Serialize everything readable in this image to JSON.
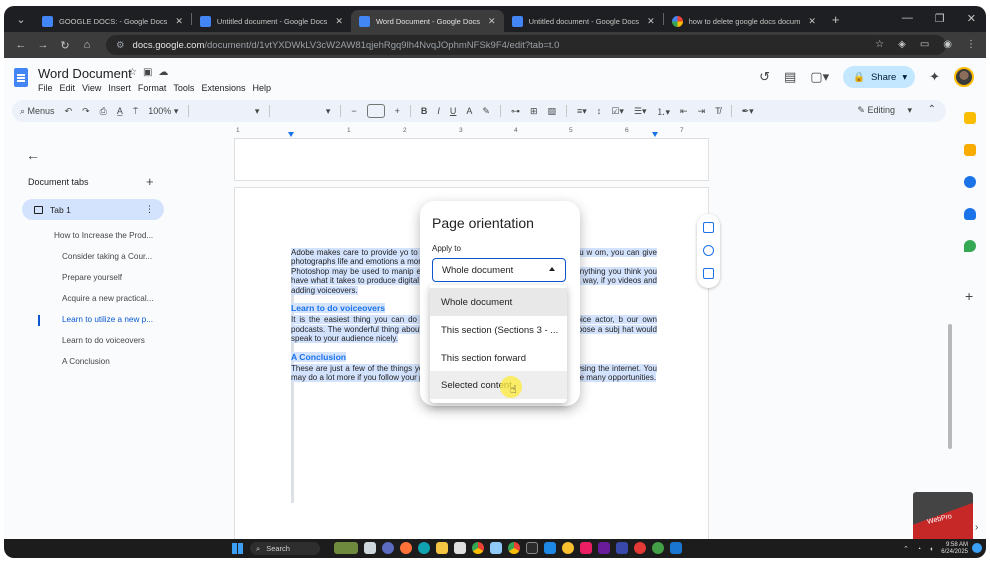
{
  "browser": {
    "tabs": [
      {
        "title": "GOOGLE DOCS: - Google Docs",
        "active": false,
        "favicon": "docs-favicon"
      },
      {
        "title": "Untitled document - Google Docs",
        "active": false,
        "favicon": "docs-favicon"
      },
      {
        "title": "Word Document - Google Docs",
        "active": true,
        "favicon": "docs-favicon"
      },
      {
        "title": "Untitled document - Google Docs",
        "active": false,
        "favicon": "docs-favicon"
      },
      {
        "title": "how to delete google docs docum",
        "active": false,
        "favicon": "google-favicon"
      }
    ],
    "new_tab": "+",
    "url_host": "docs.google.com",
    "url_path": "/document/d/1vtYXDWkLV3cW2AW81qjehRgq9lh4NvqJOphmNFSk9F4/edit?tab=t.0"
  },
  "docs": {
    "title": "Word Document",
    "menu": [
      "File",
      "Edit",
      "View",
      "Insert",
      "Format",
      "Tools",
      "Extensions",
      "Help"
    ],
    "share_label": "Share",
    "toolbar": {
      "menus_label": "Menus",
      "zoom": "100%",
      "editing_label": "Editing"
    },
    "ruler_numbers": [
      "1",
      "1",
      "2",
      "3",
      "4",
      "5",
      "6",
      "7"
    ]
  },
  "sidebar": {
    "heading": "Document tabs",
    "tab_name": "Tab 1",
    "outline": [
      {
        "text": "How to Increase the Prod...",
        "level": 1,
        "active": false
      },
      {
        "text": "Consider taking a Cour...",
        "level": 2,
        "active": false
      },
      {
        "text": "Prepare yourself",
        "level": 2,
        "active": false
      },
      {
        "text": "Acquire a new practical...",
        "level": 2,
        "active": false
      },
      {
        "text": "Learn to utilize a new p...",
        "level": 2,
        "active": true
      },
      {
        "text": "Learn to do voiceovers",
        "level": 2,
        "active": false
      },
      {
        "text": "A Conclusion",
        "level": 2,
        "active": false
      }
    ]
  },
  "document": {
    "para1": "Adobe makes care to provide yo                                           to move around so you can create anything you w                                           om, you can give photographs life and emotions a                                           more colorful and attractive.",
    "para2": "Photoshop may be used to manip                                           enormous creative potential, you can make anything                                           you think you have what it takes to produce digital a                                           artificial intelligence to assist you along the way, if yo                                           videos and adding voiceovers.",
    "heading1": "Learn to do voiceovers",
    "para3": "It is the easiest thing you can do                                           ess. You may think about working as a voice actor, b                                           our own podcasts. The wonderful thing about pod                                           provided it is not debatable. Simply choose a subj                                           hat would speak to your audience nicely.",
    "heading2": "A Conclusion",
    "para4": "These are just a few of the things you may do to maximize your time when browsing the internet. You may do a lot more if you follow your passions and use the internet, where there are many opportunities."
  },
  "dialog": {
    "title": "Page orientation",
    "apply_label": "Apply to",
    "selected_value": "Whole document",
    "options": [
      {
        "label": "Whole document",
        "state": "selected"
      },
      {
        "label": "This section (Sections 3 - ...",
        "state": "normal"
      },
      {
        "label": "This section forward",
        "state": "normal"
      },
      {
        "label": "Selected content",
        "state": "hover"
      }
    ]
  },
  "watermark": {
    "text": "WebPro"
  },
  "taskbar": {
    "search_placeholder": "Search",
    "time": "9:58 AM",
    "date": "6/24/2025"
  },
  "colors": {
    "accent": "#0b57d0",
    "selection": "#d3e3fd",
    "share_bg": "#c2e7ff",
    "heading_blue": "#1a73e8"
  }
}
